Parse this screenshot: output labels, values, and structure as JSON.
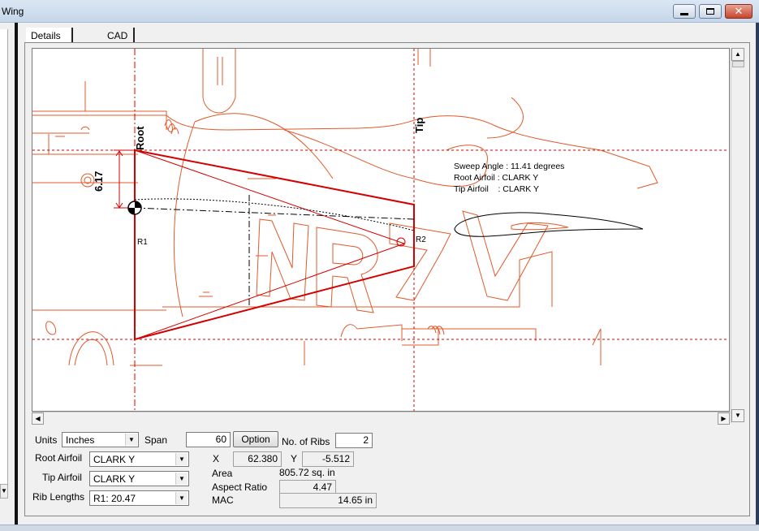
{
  "window": {
    "title": "Wing"
  },
  "tabs": [
    {
      "label": "Details"
    },
    {
      "label": "CAD"
    }
  ],
  "drawing": {
    "root_label": "Root",
    "tip_label": "Tip",
    "dimension_label": "6.17",
    "rib1_label": "R1",
    "rib2_label": "R2",
    "info_lines": [
      "Sweep Angle : 11.41 degrees",
      "Root Airfoil : CLARK Y",
      "Tip Airfoil    : CLARK Y"
    ]
  },
  "controls": {
    "units_label": "Units",
    "units_value": "Inches",
    "span_label": "Span",
    "span_value": "60",
    "option_button": "Option",
    "ribs_label": "No. of Ribs",
    "ribs_value": "2",
    "root_airfoil_label": "Root Airfoil",
    "root_airfoil_value": "CLARK Y",
    "tip_airfoil_label": "Tip Airfoil",
    "tip_airfoil_value": "CLARK Y",
    "rib_lengths_label": "Rib Lengths",
    "rib_lengths_value": "R1: 20.47",
    "x_label": "X",
    "x_value": "62.380",
    "y_label": "Y",
    "y_value": "-5.512",
    "area_label": "Area",
    "area_value": "805.72 sq. in",
    "aspect_label": "Aspect Ratio",
    "aspect_value": "4.47",
    "mac_label": "MAC",
    "mac_value": "14.65 in"
  },
  "colors": {
    "outline": "#e05a2a",
    "wing": "#d40000",
    "guide": "#d40000"
  }
}
